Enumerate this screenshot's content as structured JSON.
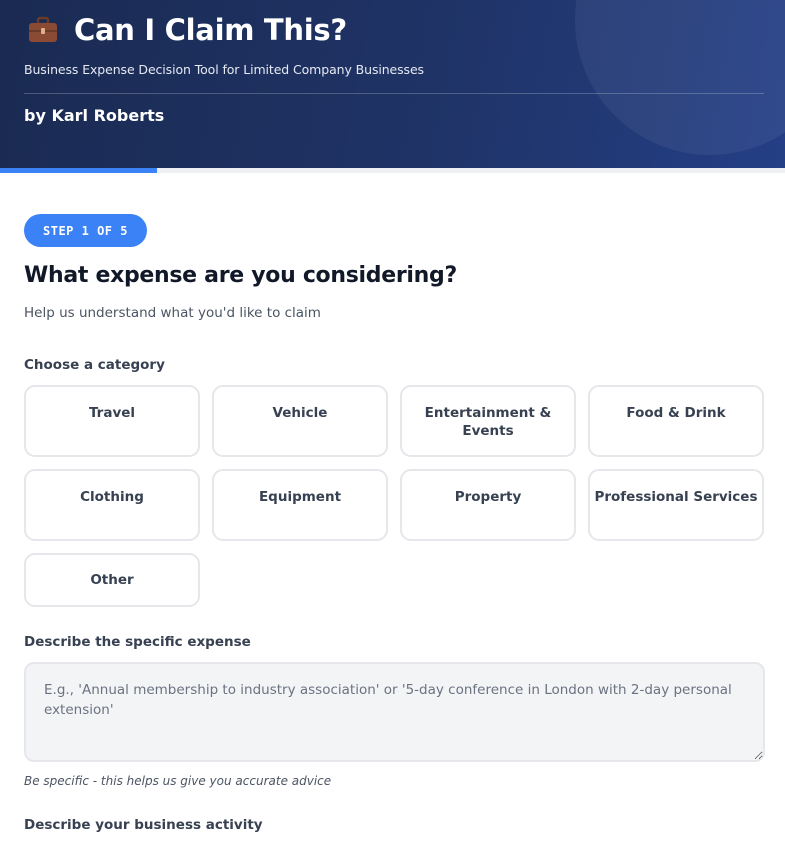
{
  "header": {
    "title": "Can I Claim This?",
    "icon": "briefcase-icon",
    "subtitle": "Business Expense Decision Tool for Limited Company Businesses",
    "author": "by Karl Roberts",
    "colors": {
      "gradient_start": "#1a2a52",
      "gradient_end": "#243f86"
    }
  },
  "progress": {
    "current_step": 1,
    "total_steps": 5,
    "fraction": 0.2,
    "color": "#3b82f6"
  },
  "step": {
    "badge": "STEP 1 OF 5",
    "title": "What expense are you considering?",
    "subtitle": "Help us understand what you'd like to claim"
  },
  "category_section": {
    "label": "Choose a category",
    "options": [
      "Travel",
      "Vehicle",
      "Entertainment & Events",
      "Food & Drink",
      "Clothing",
      "Equipment",
      "Property",
      "Professional Services",
      "Other"
    ]
  },
  "expense_field": {
    "label": "Describe the specific expense",
    "value": "",
    "placeholder": "E.g., 'Annual membership to industry association' or '5-day conference in London with 2-day personal extension'",
    "hint": "Be specific - this helps us give you accurate advice"
  },
  "business_activity": {
    "label": "Describe your business activity"
  }
}
